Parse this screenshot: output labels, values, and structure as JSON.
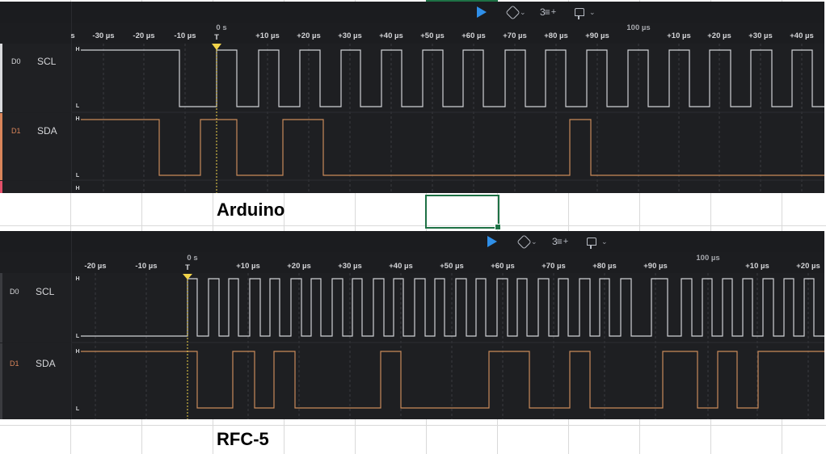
{
  "captions": {
    "first": "Arduino",
    "second": "RFC-5"
  },
  "toolbar": {
    "run_icon": "play-icon",
    "measure_icon": "hexagon-measure-icon",
    "channels_icon": "channels-add-icon",
    "channels_count": "3",
    "channels_plus": "+",
    "trigger_icon": "trigger-icon",
    "chevron": "⌄"
  },
  "colors": {
    "scl_wave": "#d0d2d6",
    "sda_wave": "#c98a5a",
    "scl_accent": "#d9dadd",
    "sda_accent": "#d9855a",
    "trigger_marker": "#f2d44a",
    "run_button": "#2f8fe8"
  },
  "panels": [
    {
      "id": "arduino",
      "trigger_zero_label": "0 s",
      "trigger_marker_label": "T",
      "ruler_ticks": [
        "s",
        "-30 µs",
        "-20 µs",
        "-10 µs",
        "+10 µs",
        "+20 µs",
        "+30 µs",
        "+40 µs",
        "+50 µs",
        "+60 µs",
        "+70 µs",
        "+80 µs",
        "+90 µs",
        "+10 µs",
        "+20 µs",
        "+30 µs",
        "+40 µs"
      ],
      "ruler_major_label": "100 µs",
      "channels": [
        {
          "id": "D0",
          "name": "SCL",
          "high": "H",
          "low": "L"
        },
        {
          "id": "D1",
          "name": "SDA",
          "high": "H",
          "low": "L"
        },
        {
          "id": "",
          "name": "",
          "high": "H",
          "low": ""
        }
      ]
    },
    {
      "id": "rfc5",
      "trigger_zero_label": "0 s",
      "trigger_marker_label": "T",
      "ruler_ticks": [
        "-20 µs",
        "-10 µs",
        "+10 µs",
        "+20 µs",
        "+30 µs",
        "+40 µs",
        "+50 µs",
        "+60 µs",
        "+70 µs",
        "+80 µs",
        "+90 µs",
        "+10 µs",
        "+20 µs"
      ],
      "ruler_major_label": "100 µs",
      "channels": [
        {
          "id": "D0",
          "name": "SCL",
          "high": "H",
          "low": "L"
        },
        {
          "id": "D1",
          "name": "SDA",
          "high": "H",
          "low": "L"
        }
      ]
    }
  ]
}
